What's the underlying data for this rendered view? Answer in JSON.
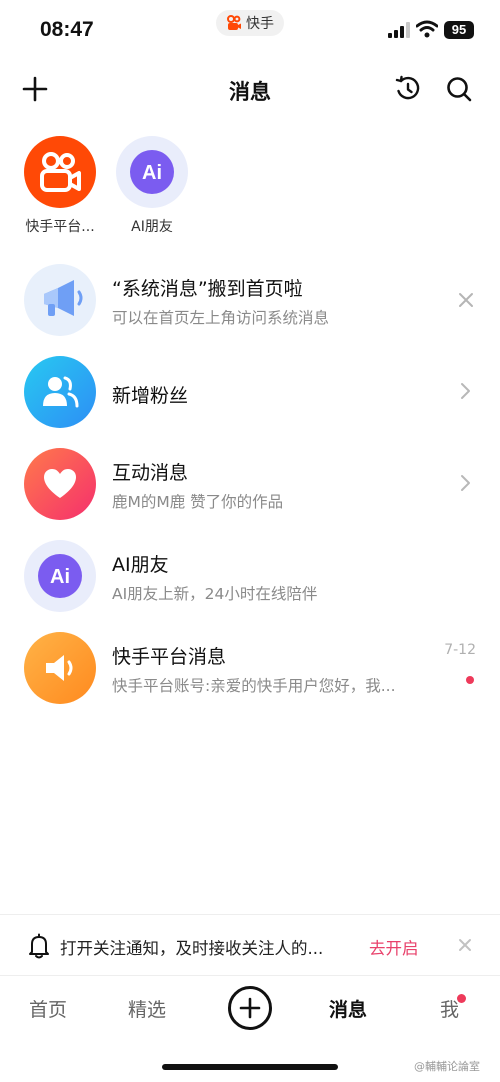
{
  "status_bar": {
    "time": "08:47",
    "app_name": "快手",
    "battery": "95"
  },
  "header": {
    "title": "消息",
    "icons": [
      "add-icon",
      "history-icon",
      "search-icon"
    ]
  },
  "quick_contacts": [
    {
      "label": "快手平台...",
      "icon": "kuaishou-logo-icon",
      "color": "#ff4906"
    },
    {
      "label": "AI朋友",
      "icon": "ai-icon",
      "color": "#7b5cf0"
    }
  ],
  "messages": [
    {
      "title": "“系统消息”搬到首页啦",
      "subtitle": "可以在首页左上角访问系统消息",
      "icon": "megaphone-icon",
      "action": "close-icon"
    },
    {
      "title": "新增粉丝",
      "subtitle": "",
      "icon": "fans-icon",
      "action": "chevron-right-icon"
    },
    {
      "title": "互动消息",
      "subtitle": "鹿M的M鹿 赞了你的作品",
      "icon": "heart-icon",
      "action": "chevron-right-icon"
    },
    {
      "title": "AI朋友",
      "subtitle": "AI朋友上新，24小时在线陪伴",
      "icon": "ai-icon"
    },
    {
      "title": "快手平台消息",
      "subtitle": "快手平台账号:亲爱的快手用户您好，我...",
      "date": "7-12",
      "icon": "speaker-icon",
      "unread": true
    }
  ],
  "notice": {
    "text": "打开关注通知，及时接收关注人的...",
    "action": "去开启"
  },
  "tabbar": {
    "tabs": [
      "首页",
      "精选",
      "消息",
      "我"
    ],
    "active": "消息"
  },
  "watermark": "@輔輔论論室",
  "colors": {
    "accent": "#e8416b",
    "unread_dot": "#ee3a5a",
    "kuaishou_orange": "#ff4906"
  }
}
